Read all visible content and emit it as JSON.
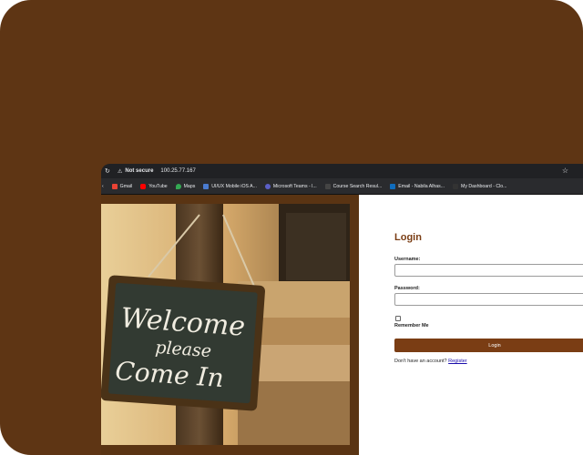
{
  "browser": {
    "security_label": "Not secure",
    "url": "100.25.77.167",
    "bookmarks": [
      {
        "label": "Gmail",
        "icon": "gmail-icon",
        "color": "#ea4335"
      },
      {
        "label": "YouTube",
        "icon": "youtube-icon",
        "color": "#ff0000"
      },
      {
        "label": "Maps",
        "icon": "maps-icon",
        "color": "#34a853"
      },
      {
        "label": "UI/UX Mobile iOS A...",
        "icon": "app-icon",
        "color": "#4a7bd0"
      },
      {
        "label": "Microsoft Teams - l...",
        "icon": "teams-icon",
        "color": "#5b5fc7"
      },
      {
        "label": "Course Search Resul...",
        "icon": "page-icon",
        "color": "#444444"
      },
      {
        "label": "Email - Nabila Alhas...",
        "icon": "outlook-icon",
        "color": "#0f6cbd"
      },
      {
        "label": "My Dashboard - Clo...",
        "icon": "dashboard-icon",
        "color": "#333333"
      }
    ]
  },
  "photo": {
    "sign_line1": "Welcome",
    "sign_line2": "please",
    "sign_line3": "Come In"
  },
  "login": {
    "title": "Login",
    "username_label": "Username:",
    "username_value": "",
    "password_label": "Password:",
    "password_value": "",
    "remember_label": "Remember Me",
    "button_label": "Login",
    "register_prompt": "Don't have an account?",
    "register_link": "Register"
  },
  "colors": {
    "brand_brown": "#7a3d14",
    "background_brown": "#5e3514"
  }
}
